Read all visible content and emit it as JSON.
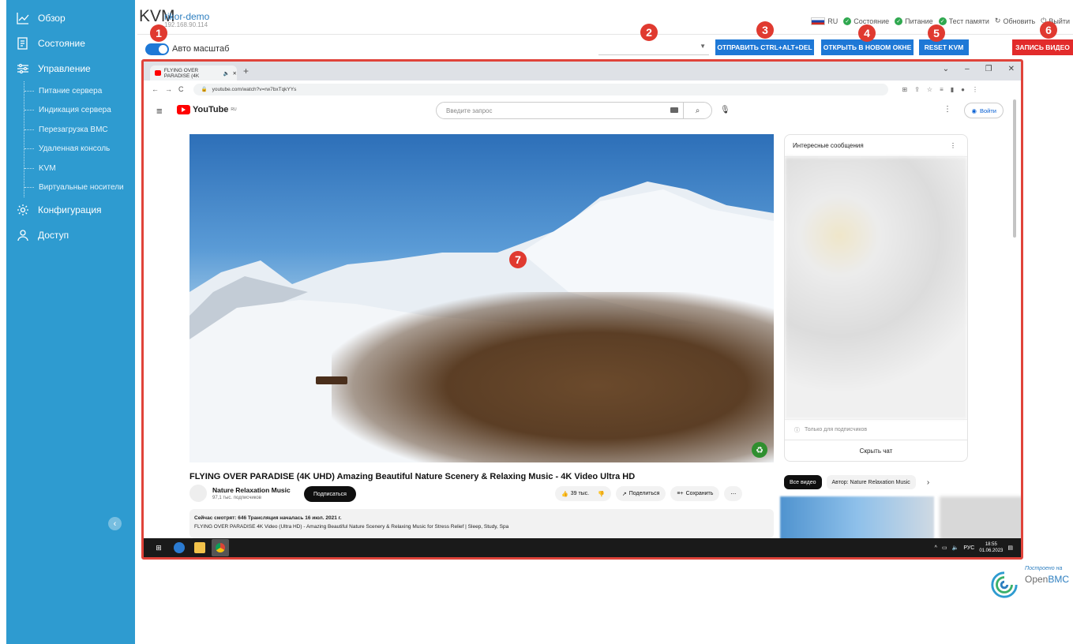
{
  "sidebar": {
    "items": [
      {
        "label": "Обзор",
        "icon": "chart-line-icon"
      },
      {
        "label": "Состояние",
        "icon": "clipboard-icon"
      },
      {
        "label": "Управление",
        "icon": "sliders-icon"
      },
      {
        "label": "Конфигурация",
        "icon": "gear-icon"
      },
      {
        "label": "Доступ",
        "icon": "user-icon"
      }
    ],
    "sub_items": [
      "Питание сервера",
      "Индикация сервера",
      "Перезагрузка BMC",
      "Удаленная консоль",
      "KVM",
      "Виртуальные носители"
    ],
    "collapse_icon": "chevron-left-icon"
  },
  "header": {
    "title": "KVM",
    "host": "rikor-demo",
    "ip": "192.168.90.114",
    "language": "RU",
    "status_items": [
      "Состояние",
      "Питание",
      "Тест памяти"
    ],
    "refresh_label": "Обновить",
    "logout_label": "Выйти"
  },
  "toolbar": {
    "auto_scale_label": "Авто масштаб",
    "auto_scale_on": true,
    "buttons": {
      "ctrl_alt_del": "ОТПРАВИТЬ CTRL+ALT+DEL",
      "new_window": "ОТКРЫТЬ В НОВОМ ОКНЕ",
      "reset_kvm": "RESET KVM",
      "record_video": "ЗАПИСЬ ВИДЕО"
    }
  },
  "badges": [
    "1",
    "2",
    "3",
    "4",
    "5",
    "6",
    "7"
  ],
  "kvm": {
    "browser": {
      "tab_title": "FLYING OVER PARADISE (4K",
      "url": "youtube.com/watch?v=rw7bxTqkYYs"
    },
    "youtube": {
      "logo_text": "YouTube",
      "region": "RU",
      "search_placeholder": "Введите запрос",
      "login_label": "Войти",
      "video_title": "FLYING OVER PARADISE (4K UHD) Amazing Beautiful Nature Scenery & Relaxing Music - 4K Video Ultra HD",
      "channel_name": "Nature Relaxation Music",
      "channel_subs": "97,1 тыс. подписчиков",
      "subscribe_label": "Подписаться",
      "likes": "39 тыс.",
      "share_label": "Поделиться",
      "save_label": "Сохранить",
      "desc_line1": "Сейчас смотрят: 646  Трансляция началась 16 июл. 2021 г.",
      "desc_line2": "FLYING OVER PARADISE 4K Video (Ultra HD) - Amazing Beautiful Nature Scenery & Relaxing Music for Stress Relief | Sleep, Study, Spa",
      "chat_title": "Интересные сообщения",
      "chat_subscribers_only": "Только для подписчиков",
      "chat_hide": "Скрыть чат",
      "related_tabs": [
        "Все видео",
        "Автор: Nature Relaxation Music"
      ]
    },
    "taskbar": {
      "lang": "РУС",
      "time": "18:55",
      "date": "01.06.2023"
    }
  },
  "branding": {
    "built_on": "Построено на",
    "name_open": "Open",
    "name_bmc": "BMC"
  },
  "colors": {
    "sidebar": "#2e9bd0",
    "primary_button": "#1e78d6",
    "record_button": "#e22b2b",
    "badge": "#e03a30",
    "frame_border": "#e0433a"
  }
}
